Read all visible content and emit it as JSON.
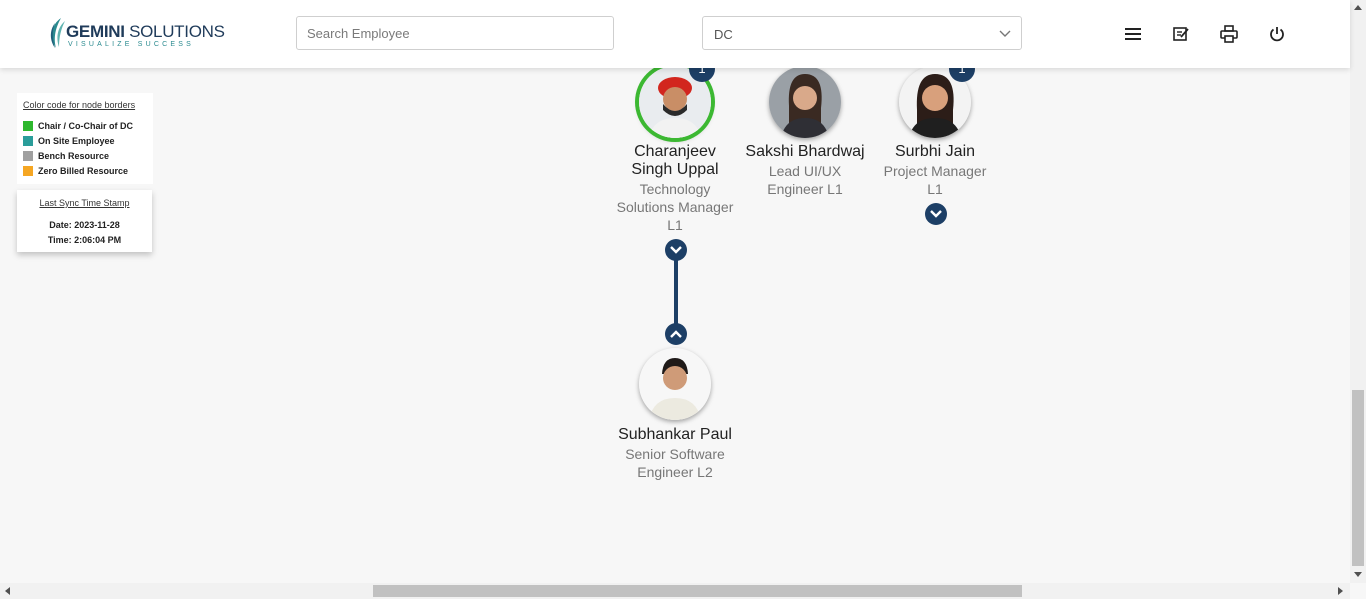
{
  "app": {
    "brand_name_bold": "GEMINI",
    "brand_name_light": "SOLUTIONS",
    "brand_tagline": "VISUALIZE SUCCESS"
  },
  "search": {
    "placeholder": "Search Employee",
    "value": ""
  },
  "filter": {
    "selected": "DC"
  },
  "toolbar": [
    "menu-icon",
    "notes-icon",
    "print-icon",
    "power-icon"
  ],
  "legend": {
    "title": "Color code for node borders",
    "items": [
      {
        "label": "Chair / Co-Chair of DC",
        "color": "#2eb82e"
      },
      {
        "label": "On Site Employee",
        "color": "#2a9d9a"
      },
      {
        "label": "Bench Resource",
        "color": "#a0a0a0"
      },
      {
        "label": "Zero Billed Resource",
        "color": "#f5a623"
      }
    ]
  },
  "sync": {
    "title": "Last Sync Time Stamp",
    "date": "Date: 2023-11-28",
    "time": "Time: 2:06:04 PM"
  },
  "nodes": [
    {
      "name": "Charanjeev Singh Uppal",
      "name_line1": "Charanjeev",
      "name_line2": "Singh Uppal",
      "title_line1": "Technology",
      "title_line2": "Solutions Manager",
      "title_line3": "L1",
      "border_color": "#3cb832",
      "badge": "1"
    },
    {
      "name": "Sakshi Bhardwaj",
      "title_line1": "Lead UI/UX",
      "title_line2": "Engineer L1"
    },
    {
      "name": "Surbhi Jain",
      "title_line1": "Project Manager",
      "title_line2": "L1",
      "badge": "1"
    },
    {
      "name": "Subhankar Paul",
      "title_line1": "Senior Software",
      "title_line2": "Engineer L2"
    }
  ],
  "colors": {
    "accent": "#1d3f66",
    "teal": "#2a8a8f"
  }
}
